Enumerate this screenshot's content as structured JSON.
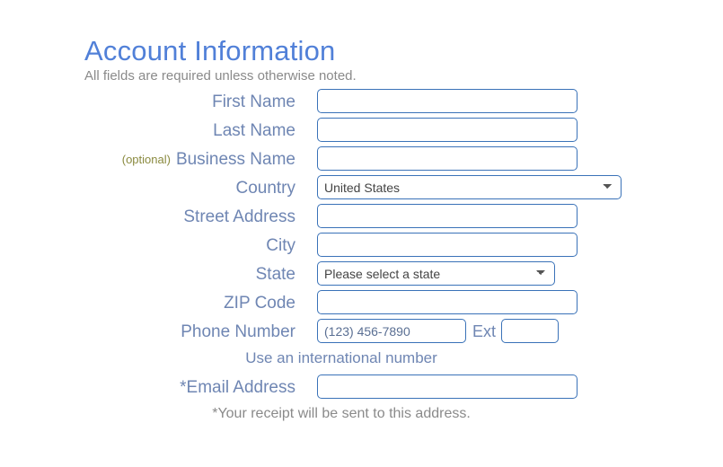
{
  "heading": {
    "title": "Account Information",
    "intro_note": "All fields are required unless otherwise noted.",
    "title_color": "#5180d8",
    "note_color": "#8a8a8a"
  },
  "colors": {
    "label": "#6f86b3",
    "optional_tag": "#8a8a3f",
    "input_border": "#3a72b8",
    "placeholder": "#5a6f93",
    "helper_note": "#8a8a8a"
  },
  "form": {
    "first_name": {
      "label": "First Name",
      "value": "",
      "placeholder": ""
    },
    "last_name": {
      "label": "Last Name",
      "value": "",
      "placeholder": ""
    },
    "business_name": {
      "optional_tag": "(optional)",
      "label": "Business Name",
      "value": "",
      "placeholder": ""
    },
    "country": {
      "label": "Country",
      "selected": "United States",
      "options": [
        "United States"
      ]
    },
    "street_address": {
      "label": "Street Address",
      "value": "",
      "placeholder": ""
    },
    "city": {
      "label": "City",
      "value": "",
      "placeholder": ""
    },
    "state": {
      "label": "State",
      "selected": "Please select a state",
      "options": [
        "Please select a state"
      ]
    },
    "zip_code": {
      "label": "ZIP Code",
      "value": "",
      "placeholder": ""
    },
    "phone_number": {
      "label": "Phone Number",
      "value": "",
      "placeholder": "(123) 456-7890",
      "ext_label": "Ext",
      "ext_value": "",
      "ext_placeholder": "",
      "helper_link": "Use an international number"
    },
    "email_address": {
      "label": "*Email Address",
      "value": "",
      "placeholder": "",
      "helper_note": "*Your receipt will be sent to this address."
    }
  }
}
